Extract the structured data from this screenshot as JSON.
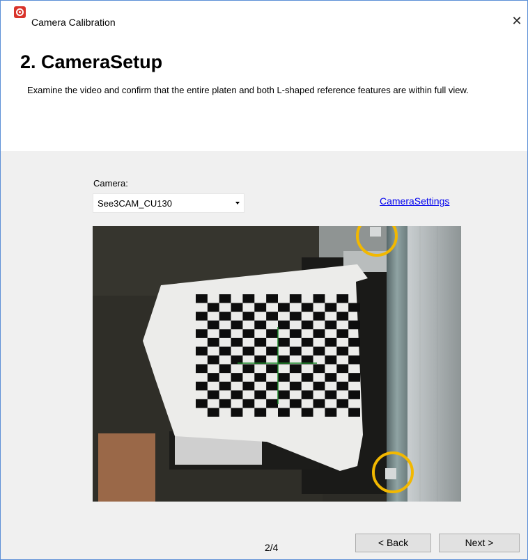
{
  "window": {
    "title": "Camera Calibration",
    "close_glyph": "✕"
  },
  "header": {
    "title": "2. CameraSetup",
    "description": "Examine the video and confirm that the entire platen and both L-shaped reference features are within full view."
  },
  "camera": {
    "label": "Camera:",
    "selected": "See3CAM_CU130"
  },
  "settings_link": "CameraSettings",
  "video": {
    "checkerboard_cols": 14,
    "checkerboard_rows": 14,
    "highlight_color": "#f2b800",
    "crosshair_color": "#1d8a2a"
  },
  "footer": {
    "page_indicator": "2/4",
    "back_label": "< Back",
    "next_label": "Next >"
  },
  "colors": {
    "window_border": "#5a8ed6",
    "content_bg": "#f0f0f0",
    "link": "#0000ee",
    "brand": "#d9342b"
  }
}
